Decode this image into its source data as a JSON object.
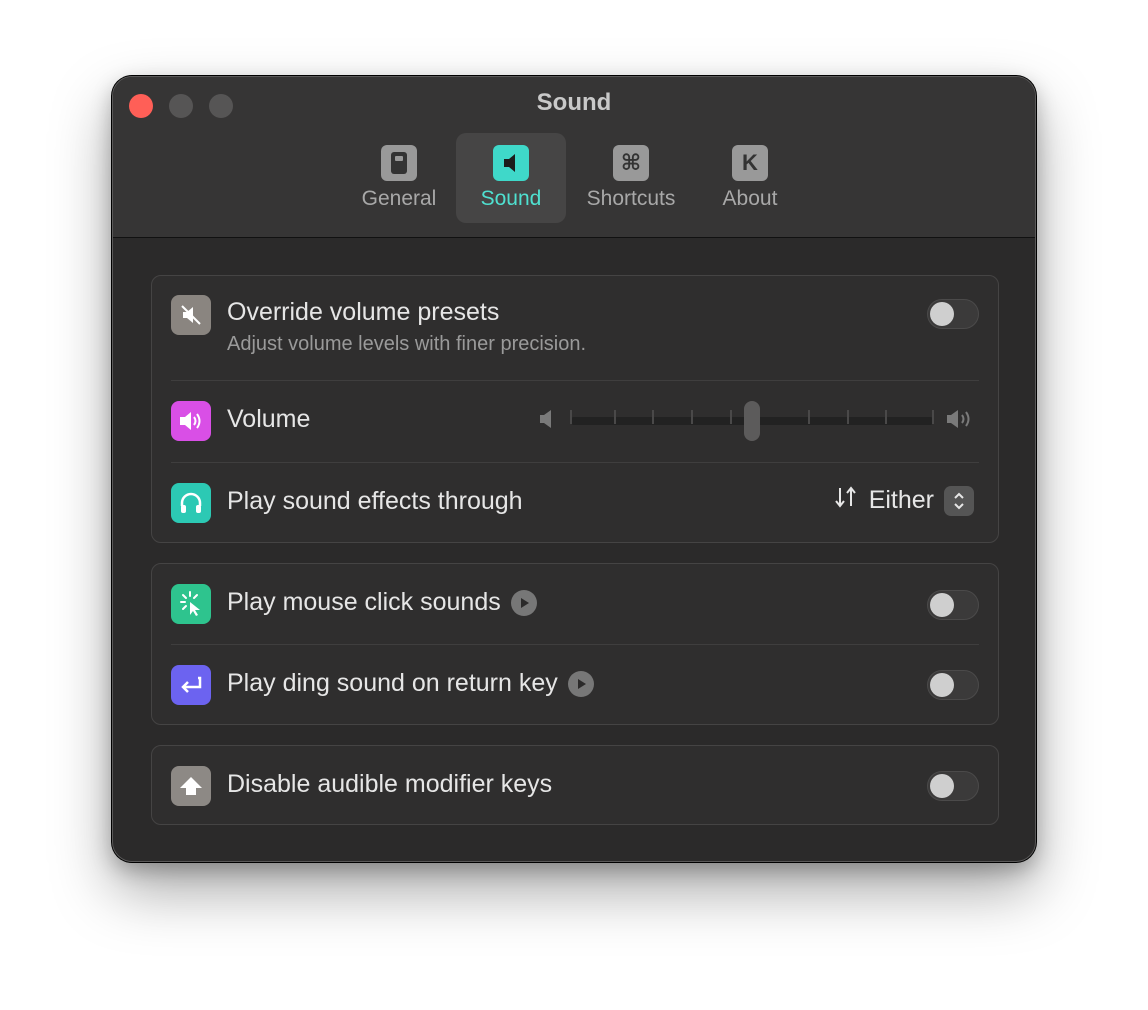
{
  "window": {
    "title": "Sound"
  },
  "tabs": [
    {
      "label": "General",
      "icon": "general-icon",
      "selected": false
    },
    {
      "label": "Sound",
      "icon": "speaker-icon",
      "selected": true
    },
    {
      "label": "Shortcuts",
      "icon": "command-icon",
      "selected": false
    },
    {
      "label": "About",
      "icon": "k-icon",
      "selected": false
    }
  ],
  "tab_glyphs": {
    "shortcuts": "⌘",
    "about": "K"
  },
  "groups": {
    "audio": {
      "override": {
        "title": "Override volume presets",
        "subtitle": "Adjust volume levels with finer precision.",
        "enabled": false
      },
      "volume": {
        "title": "Volume",
        "level": 0.5
      },
      "output": {
        "title": "Play sound effects through",
        "value": "Either"
      }
    },
    "feedback": {
      "click_sounds": {
        "title": "Play mouse click sounds",
        "enabled": false
      },
      "ding_sound": {
        "title": "Play ding sound on return key",
        "enabled": false
      }
    },
    "modifiers": {
      "audible_keys": {
        "title": "Disable audible modifier keys",
        "enabled": false
      }
    }
  },
  "colors": {
    "accent": "#3fd8c9",
    "close": "#ff5f57",
    "override_icon": "#8a8580",
    "volume_icon": "#d94fe6",
    "headphones_icon": "#2cc9b4",
    "click_icon": "#2ec48e",
    "return_icon": "#6c63f0",
    "shift_icon": "#8d8985"
  }
}
